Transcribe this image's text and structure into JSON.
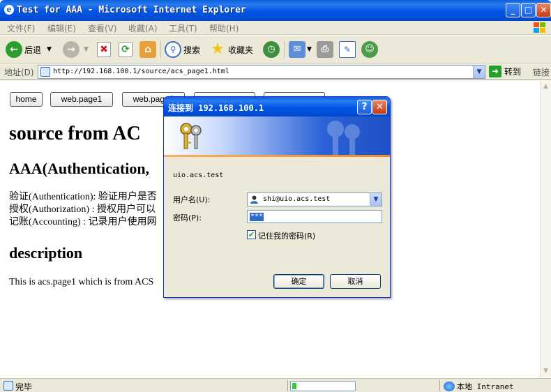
{
  "window": {
    "title": "Test for AAA - Microsoft Internet Explorer",
    "controls": {
      "minimize": "_",
      "maximize": "□",
      "close": "✕"
    }
  },
  "menu": [
    "文件(F)",
    "编辑(E)",
    "查看(V)",
    "收藏(A)",
    "工具(T)",
    "帮助(H)"
  ],
  "toolbar": {
    "back": "后退",
    "search": "搜索",
    "favorites": "收藏夹"
  },
  "address": {
    "label": "地址(D)",
    "url": "http://192.168.100.1/source/acs_page1.html",
    "go": "转到",
    "links": "链接"
  },
  "page": {
    "buttons": [
      "home",
      "web.page1",
      "web.page2",
      "",
      ""
    ],
    "heading1": "source from AC",
    "heading2": "AAA(Authentication,",
    "lines": [
      "验证(Authentication): 验证用户是否",
      "授权(Authorization) : 授权用户可以",
      "记账(Accounting) : 记录用户使用网"
    ],
    "heading3": "description",
    "description": "This is acs.page1 which is from ACS"
  },
  "dialog": {
    "title": "连接到 192.168.100.1",
    "help": "?",
    "close": "✕",
    "realm": "uio.acs.test",
    "username_label": "用户名(U):",
    "username_value": "shi@uio.acs.test",
    "password_label": "密码(P):",
    "password_value": "***",
    "remember_label": "记住我的密码(R)",
    "remember_checked": true,
    "ok": "确定",
    "cancel": "取消"
  },
  "status": {
    "text": "完毕",
    "progress": 0.03,
    "zone": "本地 Intranet"
  },
  "colors": {
    "xp_blue": "#0055e5",
    "chrome": "#ece9d8",
    "selection": "#316ac5"
  }
}
